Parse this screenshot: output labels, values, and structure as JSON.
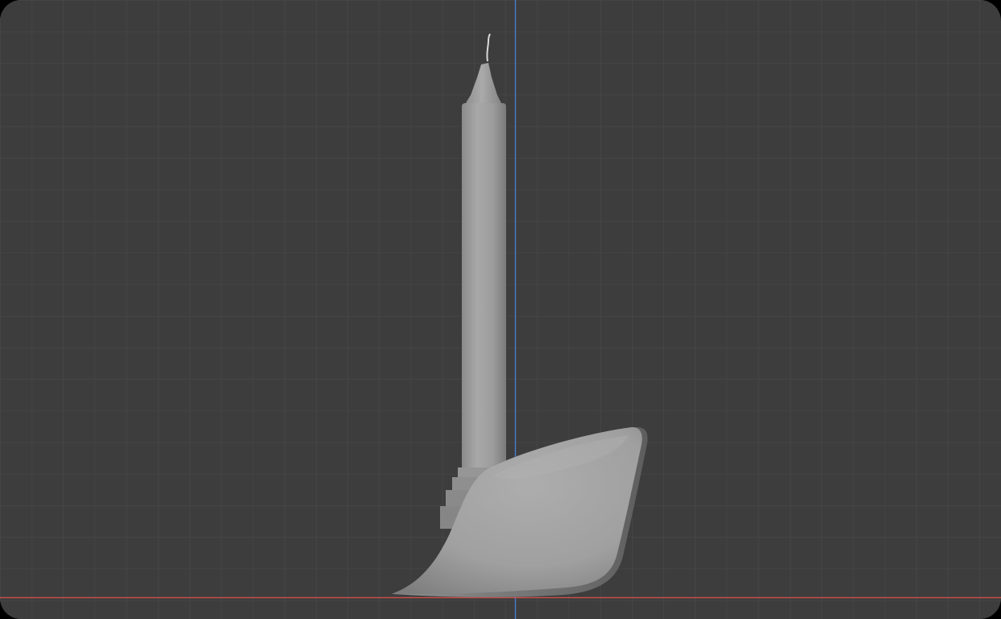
{
  "app": {
    "name": "3D viewport",
    "view": "orthographic-front"
  },
  "scene": {
    "objects": [
      {
        "name": "candle",
        "icon": "candle-mesh"
      },
      {
        "name": "candle-wick",
        "icon": "wick-curve"
      },
      {
        "name": "candle-holder-base",
        "icon": "holder-mesh"
      }
    ],
    "axes": {
      "x_axis_color": "#c0504d",
      "z_axis_color": "#4a78c2"
    }
  },
  "colors": {
    "viewport_background": "#3d3d3d",
    "grid_line": "#4b4b4b",
    "mesh_base": "#9e9e9e",
    "frame": "#000000"
  }
}
